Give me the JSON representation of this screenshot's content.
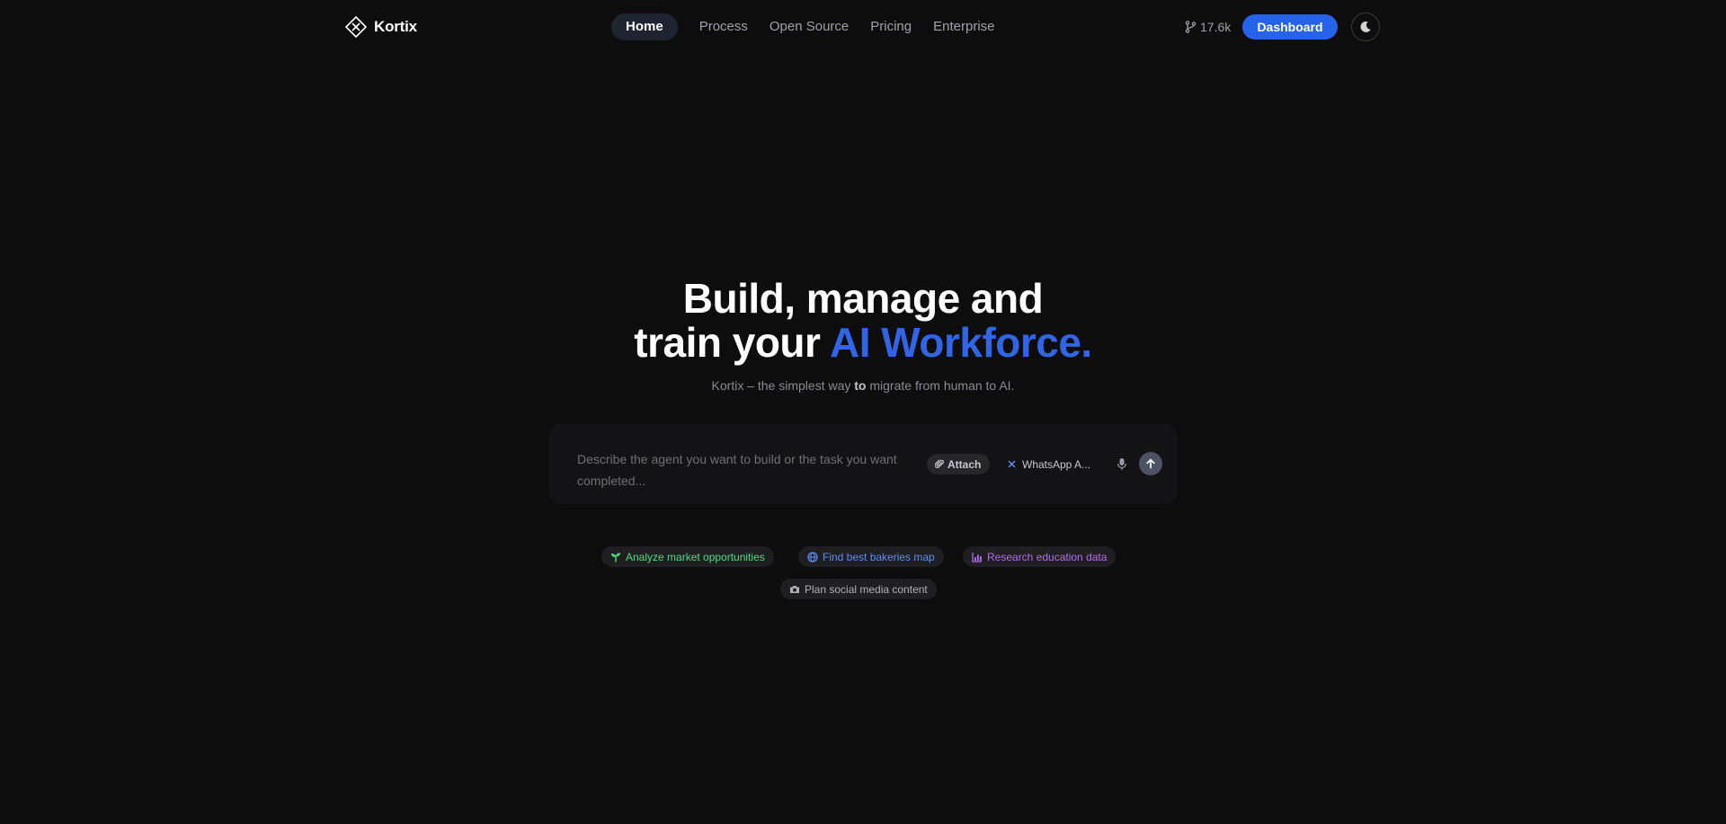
{
  "header": {
    "brand_name": "Kortix",
    "nav": [
      {
        "label": "Home",
        "active": true
      },
      {
        "label": "Process",
        "active": false
      },
      {
        "label": "Open Source",
        "active": false
      },
      {
        "label": "Pricing",
        "active": false
      },
      {
        "label": "Enterprise",
        "active": false
      }
    ],
    "github_stars": "17.6k",
    "dashboard_label": "Dashboard",
    "theme_icon": "moon-icon"
  },
  "hero": {
    "title_line1": "Build, manage and",
    "title_line2_prefix": "train your ",
    "title_line2_accent": "AI Workforce.",
    "subtitle_pre": "Kortix – the simplest way ",
    "subtitle_bold": "to",
    "subtitle_post": " migrate from human to AI."
  },
  "prompt": {
    "placeholder": "Describe the agent you want to build or the task you want completed...",
    "attach_label": "Attach",
    "agent_label": "WhatsApp A..."
  },
  "suggestions": [
    {
      "label": "Analyze market opportunities",
      "icon": "sprout-icon",
      "color": "#4ade80"
    },
    {
      "label": "Find best bakeries map",
      "icon": "globe-icon",
      "color": "#5b8ef5"
    },
    {
      "label": "Research education data",
      "icon": "bar-chart-icon",
      "color": "#b26cf0"
    },
    {
      "label": "Plan social media content",
      "icon": "camera-icon",
      "color": "#b0b0b8"
    }
  ],
  "colors": {
    "background": "#0d0d0d",
    "accent": "#2563eb",
    "title_accent": "#2f65e6"
  }
}
